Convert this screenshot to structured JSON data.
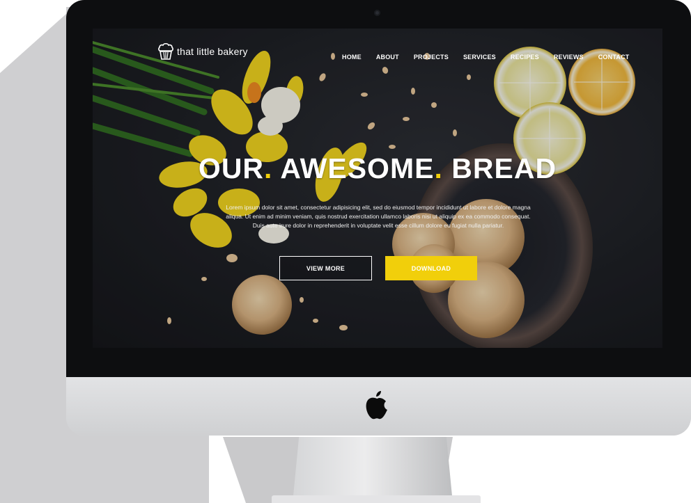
{
  "site": {
    "logo_text": "that little bakery",
    "logo_icon": "cupcake-icon"
  },
  "nav": {
    "items": [
      {
        "label": "HOME"
      },
      {
        "label": "ABOUT"
      },
      {
        "label": "PROJECTS"
      },
      {
        "label": "SERVICES"
      },
      {
        "label": "RECIPES"
      },
      {
        "label": "REVIEWS"
      },
      {
        "label": "CONTACT"
      }
    ]
  },
  "hero": {
    "title_part1": "OUR",
    "title_part2": "AWESOME",
    "title_part3": "BREAD",
    "title_dot": ".",
    "subtitle_line1": "Lorem ipsum dolor sit amet, consectetur adipisicing elit, sed do eiusmod tempor incididunt ut labore et dolore magna",
    "subtitle_line2": "aliqua. Ut enim ad minim veniam, quis nostrud exercitation ullamco laboris nisi ut aliquip ex ea commodo consequat.",
    "subtitle_line3": "Duis aute irure dolor in reprehenderit in voluptate velit esse cillum dolore eu fugiat nulla pariatur.",
    "view_more_label": "VIEW MORE",
    "download_label": "DOWNLOAD"
  },
  "colors": {
    "accent": "#f1cf0b",
    "background": "#1b1d21",
    "text": "#ffffff"
  },
  "device": {
    "brand_icon": "apple-logo-icon"
  }
}
